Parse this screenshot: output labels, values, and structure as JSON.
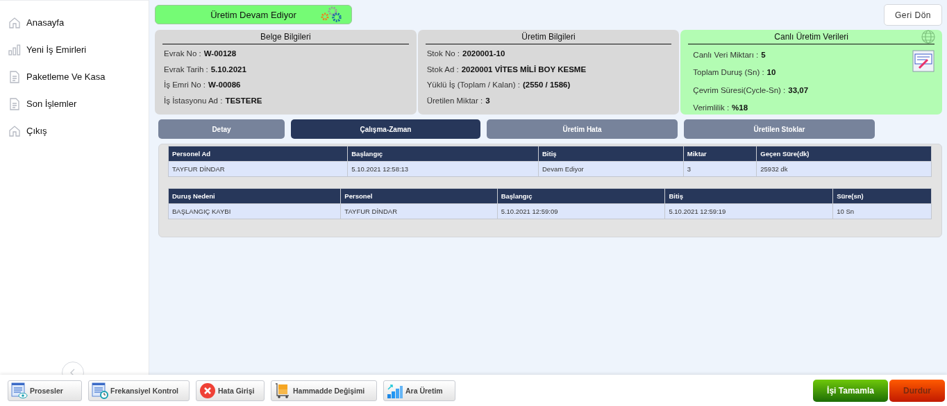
{
  "sidebar": {
    "items": [
      {
        "label": "Anasayfa",
        "kind": "home"
      },
      {
        "label": "Yeni İş Emirleri",
        "kind": "bars"
      },
      {
        "label": "Paketleme Ve Kasa",
        "kind": "doc"
      },
      {
        "label": "Son İşlemler",
        "kind": "doc"
      },
      {
        "label": "Çıkış",
        "kind": "home"
      }
    ]
  },
  "status": {
    "label": "Üretim Devam Ediyor"
  },
  "back_button": "Geri Dön",
  "cards": [
    {
      "title": "Belge Bilgileri",
      "kind": "info",
      "fields": [
        {
          "label": "Evrak No :",
          "value": "W-00128"
        },
        {
          "label": "Evrak Tarih :",
          "value": "5.10.2021"
        },
        {
          "label": "İş Emri No :",
          "value": "W-00086"
        },
        {
          "label": "İş İstasyonu Ad :",
          "value": "TESTERE"
        }
      ]
    },
    {
      "title": "Üretim Bilgileri",
      "kind": "info",
      "fields": [
        {
          "label": "Stok No :",
          "value": "2020001-10"
        },
        {
          "label": "Stok Ad :",
          "value": "2020001 VİTES MİLİ BOY KESME"
        },
        {
          "label": "Yüklü İş (Toplam / Kalan) :",
          "value": "(2550 / 1586)"
        },
        {
          "label": "Üretilen Miktar :",
          "value": "3"
        }
      ]
    },
    {
      "title": "Canlı Üretim Verileri",
      "kind": "live",
      "fields": [
        {
          "label": "Canlı Veri Miktarı :",
          "value": "5"
        },
        {
          "label": "Toplam Duruş (Sn) :",
          "value": "10"
        },
        {
          "label": "Çevrim Süresi(Cycle-Sn) :",
          "value": "33,07"
        },
        {
          "label": "Verimlilik :",
          "value": "%18"
        }
      ]
    }
  ],
  "tabs": [
    {
      "label": "Detay",
      "selected": false
    },
    {
      "label": "Çalışma-Zaman",
      "selected": true
    },
    {
      "label": "Üretim Hata",
      "selected": false
    },
    {
      "label": "Üretilen Stoklar",
      "selected": false
    }
  ],
  "tables": [
    {
      "columns": [
        "Personel Ad",
        "Başlangıç",
        "Bitiş",
        "Miktar",
        "Geçen Süre(dk)"
      ],
      "rows": [
        [
          "TAYFUR DİNDAR",
          "5.10.2021 12:58:13",
          "Devam Ediyor",
          "3",
          "25932 dk"
        ]
      ]
    },
    {
      "columns": [
        "Duruş Nedeni",
        "Personel",
        "Başlangıç",
        "Bitiş",
        "Süre(sn)"
      ],
      "rows": [
        [
          "BAŞLANGIÇ KAYBI",
          "TAYFUR DİNDAR",
          "5.10.2021 12:59:09",
          "5.10.2021 12:59:19",
          "10 Sn"
        ]
      ]
    }
  ],
  "footer_buttons": [
    {
      "label": "Prosesler",
      "kind": "list-eye"
    },
    {
      "label": "Frekansiyel Kontrol",
      "kind": "list-clock"
    },
    {
      "label": "Hata Girişi",
      "kind": "error"
    },
    {
      "label": "Hammadde Değişimi",
      "kind": "cart"
    },
    {
      "label": "Ara Üretim",
      "kind": "steps"
    }
  ],
  "actions": [
    {
      "label": "İşi Tamamla",
      "kind": "complete"
    },
    {
      "label": "Durdur",
      "kind": "stop"
    }
  ]
}
